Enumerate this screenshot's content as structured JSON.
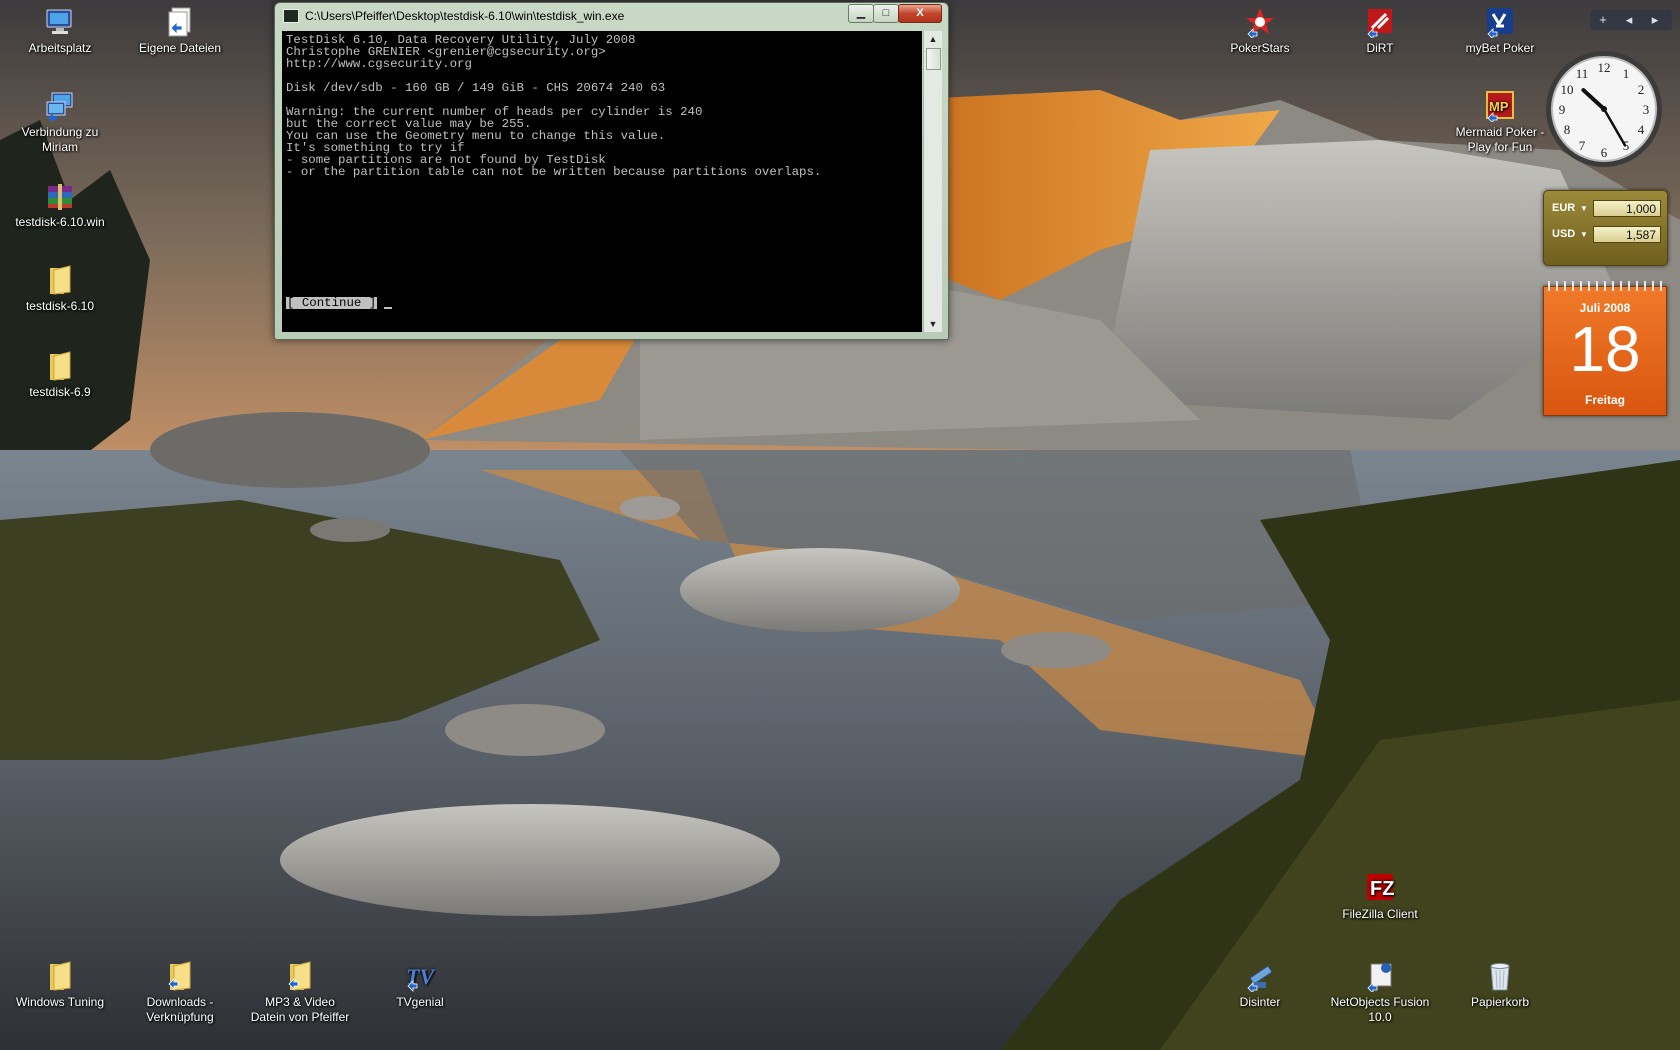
{
  "desktop": {
    "icons_left": [
      {
        "label": "Arbeitsplatz",
        "icon": "computer-icon"
      },
      {
        "label": "Eigene Dateien",
        "icon": "documents-shortcut-icon"
      },
      {
        "label": "Verbindung zu Miriam",
        "icon": "network-connection-icon"
      },
      {
        "label": "testdisk-6.10.win",
        "icon": "archive-icon"
      },
      {
        "label": "testdisk-6.10",
        "icon": "folder-icon"
      },
      {
        "label": "testdisk-6.9",
        "icon": "folder-icon"
      }
    ],
    "icons_bottom": [
      {
        "label": "Windows Tuning",
        "icon": "folder-icon"
      },
      {
        "label": "Downloads - Verknüpfung",
        "icon": "folder-shortcut-icon"
      },
      {
        "label": "MP3 & Video Datein von Pfeiffer",
        "icon": "folder-shortcut-icon"
      },
      {
        "label": "TVgenial",
        "icon": "tvgenial-icon"
      }
    ],
    "icons_right": [
      {
        "label": "PokerStars",
        "icon": "pokerstars-icon"
      },
      {
        "label": "DiRT",
        "icon": "dirt-icon"
      },
      {
        "label": "myBet Poker",
        "icon": "mybet-poker-icon"
      },
      {
        "label": "Mermaid Poker - Play for Fun",
        "icon": "mermaid-poker-icon"
      },
      {
        "label": "FileZilla Client",
        "icon": "filezilla-icon"
      },
      {
        "label": "Disinter",
        "icon": "disinter-icon"
      },
      {
        "label": "NetObjects Fusion 10.0",
        "icon": "netobjects-icon"
      },
      {
        "label": "Papierkorb",
        "icon": "recycle-bin-icon"
      }
    ]
  },
  "window": {
    "title": "C:\\Users\\Pfeiffer\\Desktop\\testdisk-6.10\\win\\testdisk_win.exe",
    "min_label": "▁",
    "max_label": "□",
    "close_label": "X",
    "console_text": "TestDisk 6.10, Data Recovery Utility, July 2008\nChristophe GRENIER <grenier@cgsecurity.org>\nhttp://www.cgsecurity.org\n\nDisk /dev/sdb - 160 GB / 149 GiB - CHS 20674 240 63\n\nWarning: the current number of heads per cylinder is 240\nbut the correct value may be 255.\nYou can use the Geometry menu to change this value.\nIt's something to try if\n- some partitions are not found by TestDisk\n- or the partition table can not be written because partitions overlaps.",
    "continue_label": "[ Continue ]"
  },
  "gadgets": {
    "sidebar_controls": [
      "+",
      "◂",
      "▸"
    ],
    "currency": [
      {
        "code": "EUR",
        "value": "1,000"
      },
      {
        "code": "USD",
        "value": "1,587"
      }
    ],
    "calendar": {
      "month": "Juli 2008",
      "day": "18",
      "weekday": "Freitag"
    },
    "clock": {
      "hour": 10,
      "minute": 25
    }
  },
  "colors": {
    "console_bg": "#000000",
    "console_fg": "#c0c0c0",
    "calendar_bg": "#e8661c",
    "currency_bg": "#8a7a30"
  }
}
